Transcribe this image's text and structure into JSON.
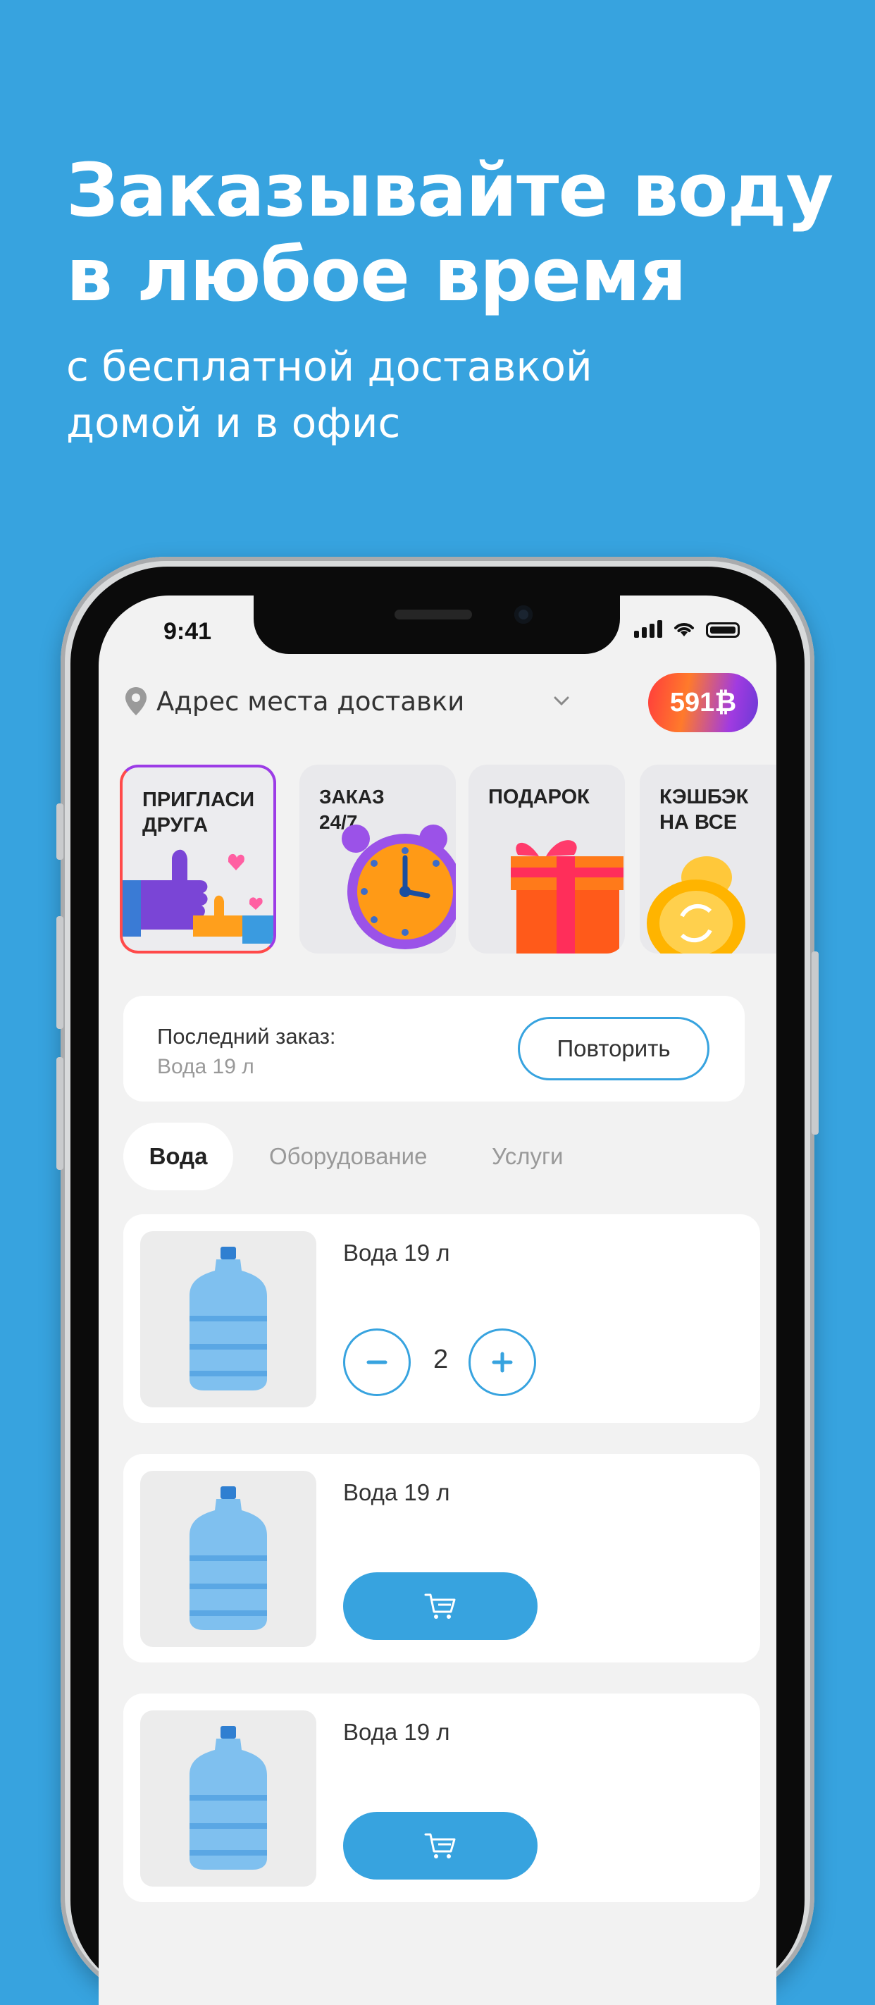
{
  "promo": {
    "headline_line1": "Заказывайте воду",
    "headline_line2": "в любое время",
    "subline_line1": "с бесплатной доставкой",
    "subline_line2": "домой и в офис"
  },
  "status_bar": {
    "time": "9:41"
  },
  "header": {
    "address_placeholder": "Адрес места доставки",
    "bonus_balance": "591₿"
  },
  "stories": [
    {
      "line1": "ПРИГЛАСИ",
      "line2": "ДРУГА"
    },
    {
      "line1": "ЗАКАЗ",
      "line2": "24/7"
    },
    {
      "line1": "ПОДАРОК",
      "line2": ""
    },
    {
      "line1": "КЭШБЭК",
      "line2": "НА ВСЕ"
    }
  ],
  "last_order": {
    "title": "Последний заказ:",
    "item": "Вода 19 л",
    "repeat_label": "Повторить"
  },
  "tabs": [
    {
      "label": "Вода",
      "active": true
    },
    {
      "label": "Оборудование",
      "active": false
    },
    {
      "label": "Услуги",
      "active": false
    }
  ],
  "products": [
    {
      "name": "Вода 19 л",
      "quantity": "2"
    },
    {
      "name": "Вода 19 л"
    },
    {
      "name": "Вода 19 л"
    }
  ],
  "colors": {
    "brand_blue": "#37a3df",
    "screen_bg": "#f2f2f2",
    "card_bg": "#ffffff"
  }
}
